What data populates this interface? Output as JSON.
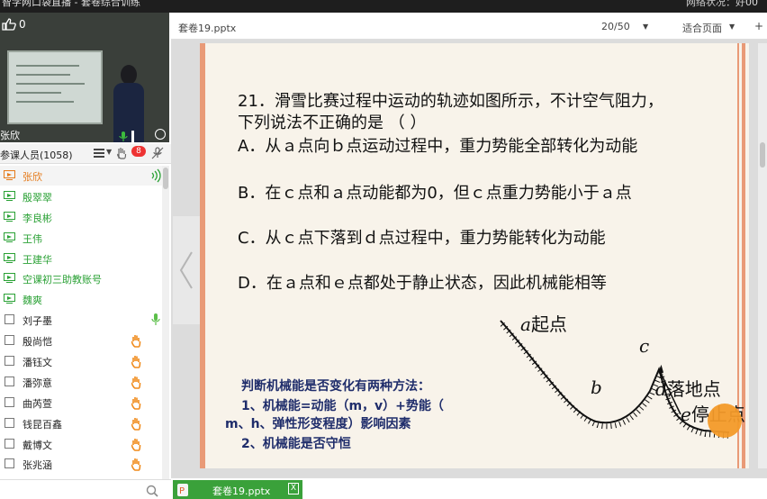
{
  "window": {
    "title": "智学网口袋直播 - 套卷综合训练",
    "network_label": "网络状况：好",
    "counter": "00"
  },
  "video": {
    "like_count": "0",
    "presenter_name": "张欣"
  },
  "members": {
    "header_label": "参课人员(1058)",
    "badge": "8",
    "items": [
      {
        "name": "张欣",
        "role": "teacher"
      },
      {
        "name": "殷翠翠",
        "role": "assist"
      },
      {
        "name": "李良彬",
        "role": "assist"
      },
      {
        "name": "王伟",
        "role": "assist"
      },
      {
        "name": "王建华",
        "role": "assist"
      },
      {
        "name": "空课初三助教账号",
        "role": "assist"
      },
      {
        "name": "魏爽",
        "role": "assist"
      },
      {
        "name": "刘子墨",
        "role": "student"
      },
      {
        "name": "殷尚恺",
        "role": "student"
      },
      {
        "name": "潘钰文",
        "role": "student"
      },
      {
        "name": "潘弥意",
        "role": "student"
      },
      {
        "name": "曲芮萱",
        "role": "student"
      },
      {
        "name": "钱昆百鑫",
        "role": "student"
      },
      {
        "name": "戴博文",
        "role": "student"
      },
      {
        "name": "张兆涵",
        "role": "student"
      }
    ]
  },
  "viewer": {
    "file_name": "套卷19.pptx",
    "page_indicator": "20/50",
    "fit_label": "适合页面",
    "more_icon": "more-icon"
  },
  "slide": {
    "question_line1": "21．滑雪比赛过程中运动的轨迹如图所示，不计空气阻力，",
    "question_line2": "下列说法不正确的是 （        ）",
    "option_a": "A．从ａ点向ｂ点运动过程中，重力势能全部转化为动能",
    "option_b": "B．在ｃ点和ａ点动能都为0，但ｃ点重力势能小于ａ点",
    "option_c": "C．从ｃ点下落到ｄ点过程中，重力势能转化为动能",
    "option_d": "D．在ａ点和ｅ点都处于静止状态，因此机械能相等",
    "method_title": "判断机械能是否变化有两种方法：",
    "method_1": "1、机械能=动能（m，v）+势能（",
    "method_1b": "m、h、弹性形变程度）影响因素",
    "method_2": "2、机械能是否守恒",
    "label_a_letter": "a",
    "label_a_text": "起点",
    "label_b": "b",
    "label_c": "c",
    "label_d_letter": "d",
    "label_d_text": "落地点",
    "label_e_letter": "e",
    "label_e_text": "停止点"
  },
  "tabs": [
    {
      "label": "套卷19.pptx",
      "close": "X"
    }
  ],
  "colors": {
    "accent_green": "#3aa13a",
    "teacher_orange": "#e57a1a",
    "slide_border": "#e99a77",
    "method_blue": "#1f2d6b"
  }
}
